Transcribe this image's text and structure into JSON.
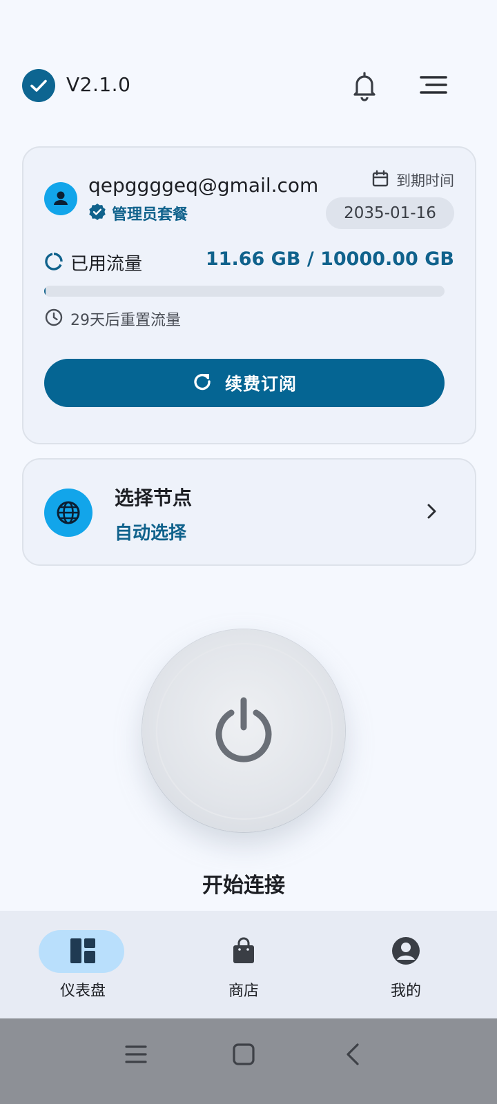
{
  "header": {
    "version": "V2.1.0"
  },
  "account": {
    "email": "qepggggeq@gmail.com",
    "plan": "管理员套餐",
    "expire_label": "到期时间",
    "expire_date": "2035-01-16",
    "usage_label": "已用流量",
    "usage_value": "11.66 GB / 10000.00 GB",
    "usage_fraction": 0.001166,
    "reset_text": "29天后重置流量",
    "renew_label": "续费订阅"
  },
  "node": {
    "title": "选择节点",
    "subtitle": "自动选择"
  },
  "connect": {
    "label": "开始连接"
  },
  "bottom_nav": {
    "items": [
      {
        "label": "仪表盘",
        "icon": "dashboard-icon",
        "active": true
      },
      {
        "label": "商店",
        "icon": "shopping-bag-icon",
        "active": false
      },
      {
        "label": "我的",
        "icon": "account-circle-icon",
        "active": false
      }
    ]
  },
  "colors": {
    "accent": "#10628c",
    "button": "#056593",
    "avatar_bg": "#12a5ea",
    "nav_pill": "#b9dffc"
  }
}
